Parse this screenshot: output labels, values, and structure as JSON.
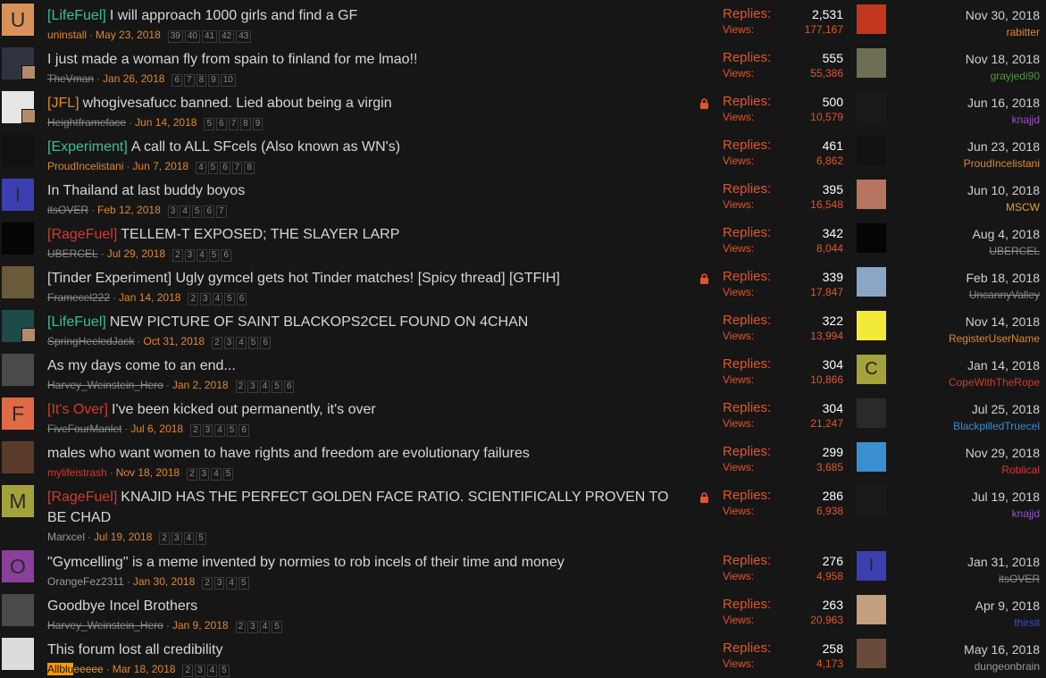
{
  "threads": [
    {
      "avatar_letter": "U",
      "avatar_color": "#d9915a",
      "prefix": "[LifeFuel]",
      "prefix_color": "#3dbd9f",
      "title": "I will approach 1000 girls and find a GF",
      "author": "uninstall",
      "author_color": "#e0882a",
      "date": "May 23, 2018",
      "pages": [
        "39",
        "40",
        "41",
        "42",
        "43"
      ],
      "locked": false,
      "replies_label": "Replies:",
      "replies": "2,531",
      "views_label": "Views:",
      "views": "177,167",
      "last_avatar_color": "#c4371f",
      "last_date": "Nov 30, 2018",
      "last_user": "rabitter",
      "last_user_color": "#e0882a"
    },
    {
      "avatar_letter": "",
      "avatar_color": "#2f3340",
      "prefix": "",
      "prefix_color": "",
      "title": "I just made a woman fly from spain to finland for me lmao!!",
      "author": "TheVman",
      "author_color": "#8a8a8a",
      "date": "Jan 26, 2018",
      "pages": [
        "6",
        "7",
        "8",
        "9",
        "10"
      ],
      "locked": false,
      "replies_label": "Replies:",
      "replies": "555",
      "views_label": "Views:",
      "views": "55,386",
      "last_avatar_color": "#6e6e52",
      "last_date": "Nov 18, 2018",
      "last_user": "grayjedi90",
      "last_user_color": "#4f9a3f"
    },
    {
      "avatar_letter": "",
      "avatar_color": "#e6e6e6",
      "prefix": "[JFL]",
      "prefix_color": "#e0882a",
      "title": "whogivesafucc banned. Lied about being a virgin",
      "author": "Heightframeface",
      "author_color": "#8a8a8a",
      "date": "Jun 14, 2018",
      "pages": [
        "5",
        "6",
        "7",
        "8",
        "9"
      ],
      "locked": true,
      "replies_label": "Replies:",
      "replies": "500",
      "views_label": "Views:",
      "views": "10,579",
      "last_avatar_color": "#1a1a1a",
      "last_date": "Jun 16, 2018",
      "last_user": "knajjd",
      "last_user_color": "#9b4fd1"
    },
    {
      "avatar_letter": "",
      "avatar_color": "#111111",
      "prefix": "[Experiment]",
      "prefix_color": "#3dbd9f",
      "title": "A call to ALL SFcels (Also known as WN's)",
      "author": "ProudIncelistani",
      "author_color": "#e0882a",
      "date": "Jun 7, 2018",
      "pages": [
        "4",
        "5",
        "6",
        "7",
        "8"
      ],
      "locked": false,
      "replies_label": "Replies:",
      "replies": "461",
      "views_label": "Views:",
      "views": "6,862",
      "last_avatar_color": "#111111",
      "last_date": "Jun 23, 2018",
      "last_user": "ProudIncelistani",
      "last_user_color": "#e0882a"
    },
    {
      "avatar_letter": "I",
      "avatar_color": "#3b3fb0",
      "prefix": "",
      "prefix_color": "",
      "title": "In Thailand at last buddy boyos",
      "author": "itsOVER",
      "author_color": "#8a8a8a",
      "date": "Feb 12, 2018",
      "pages": [
        "3",
        "4",
        "5",
        "6",
        "7"
      ],
      "locked": false,
      "replies_label": "Replies:",
      "replies": "395",
      "views_label": "Views:",
      "views": "16,548",
      "last_avatar_color": "#b57560",
      "last_date": "Jun 10, 2018",
      "last_user": "MSCW",
      "last_user_color": "#e0a02a"
    },
    {
      "avatar_letter": "",
      "avatar_color": "#050505",
      "prefix": "[RageFuel]",
      "prefix_color": "#d23b2a",
      "title": "TELLEM-T EXPOSED; THE SLAYER LARP",
      "author": "UBERCEL",
      "author_color": "#8a8a8a",
      "date": "Jul 29, 2018",
      "pages": [
        "2",
        "3",
        "4",
        "5",
        "6"
      ],
      "locked": false,
      "replies_label": "Replies:",
      "replies": "342",
      "views_label": "Views:",
      "views": "8,044",
      "last_avatar_color": "#050505",
      "last_date": "Aug 4, 2018",
      "last_user": "UBERCEL",
      "last_user_color": "#8a8a8a"
    },
    {
      "avatar_letter": "",
      "avatar_color": "#6b5a3a",
      "prefix": "",
      "prefix_color": "",
      "title": "[Tinder Experiment] Ugly gymcel gets hot Tinder matches! [Spicy thread] [GTFIH]",
      "author": "Framecel222",
      "author_color": "#8a8a8a",
      "date": "Jan 14, 2018",
      "pages": [
        "2",
        "3",
        "4",
        "5",
        "6"
      ],
      "locked": true,
      "replies_label": "Replies:",
      "replies": "339",
      "views_label": "Views:",
      "views": "17,847",
      "last_avatar_color": "#8aa6c4",
      "last_date": "Feb 18, 2018",
      "last_user": "UncannyValley",
      "last_user_color": "#8a8a8a"
    },
    {
      "avatar_letter": "",
      "avatar_color": "#1f4a4a",
      "prefix": "[LifeFuel]",
      "prefix_color": "#3dbd9f",
      "title": "NEW PICTURE OF SAINT BLACKOPS2CEL FOUND ON 4CHAN",
      "author": "SpringHeeledJack",
      "author_color": "#8a8a8a",
      "date": "Oct 31, 2018",
      "pages": [
        "2",
        "3",
        "4",
        "5",
        "6"
      ],
      "locked": false,
      "replies_label": "Replies:",
      "replies": "322",
      "views_label": "Views:",
      "views": "13,994",
      "last_avatar_color": "#f2e93a",
      "last_date": "Nov 14, 2018",
      "last_user": "RegisterUserName",
      "last_user_color": "#e0882a"
    },
    {
      "avatar_letter": "",
      "avatar_color": "#4a4a4a",
      "prefix": "",
      "prefix_color": "",
      "title": "As my days come to an end...",
      "author": "Harvey_Weinstein_Hero",
      "author_color": "#8a8a8a",
      "date": "Jan 2, 2018",
      "pages": [
        "2",
        "3",
        "4",
        "5",
        "6"
      ],
      "locked": false,
      "replies_label": "Replies:",
      "replies": "304",
      "views_label": "Views:",
      "views": "10,866",
      "last_avatar_letter": "C",
      "last_avatar_color": "#a3a33a",
      "last_date": "Jan 14, 2018",
      "last_user": "CopeWithTheRope",
      "last_user_color": "#d23b2a"
    },
    {
      "avatar_letter": "F",
      "avatar_color": "#e06a45",
      "prefix": "[It's Over]",
      "prefix_color": "#d23b2a",
      "title": "I've been kicked out permanently, it's over",
      "author": "FiveFourManlet",
      "author_color": "#8a8a8a",
      "date": "Jul 6, 2018",
      "pages": [
        "2",
        "3",
        "4",
        "5",
        "6"
      ],
      "locked": false,
      "replies_label": "Replies:",
      "replies": "304",
      "views_label": "Views:",
      "views": "21,247",
      "last_avatar_color": "#2a2a2a",
      "last_date": "Jul 25, 2018",
      "last_user": "BlackpilledTruecel",
      "last_user_color": "#3a8fd1"
    },
    {
      "avatar_letter": "",
      "avatar_color": "#5a3a2a",
      "prefix": "",
      "prefix_color": "",
      "title": "males who want women to have rights and freedom are evolutionary failures",
      "author": "mylifeistrash",
      "author_color": "#d23b2a",
      "date": "Nov 18, 2018",
      "pages": [
        "2",
        "3",
        "4",
        "5"
      ],
      "locked": false,
      "replies_label": "Replies:",
      "replies": "299",
      "views_label": "Views:",
      "views": "3,685",
      "last_avatar_color": "#3a8fd1",
      "last_date": "Nov 29, 2018",
      "last_user": "Roblical",
      "last_user_color": "#d23b2a"
    },
    {
      "avatar_letter": "M",
      "avatar_color": "#a3a33a",
      "prefix": "[RageFuel]",
      "prefix_color": "#d23b2a",
      "title": "KNAJID HAS THE PERFECT GOLDEN FACE RATIO. SCIENTIFICALLY PROVEN TO BE CHAD",
      "author": "Marxcel",
      "author_color": "#9a9a9a",
      "date": "Jul 19, 2018",
      "pages": [
        "2",
        "3",
        "4",
        "5"
      ],
      "locked": true,
      "replies_label": "Replies:",
      "replies": "286",
      "views_label": "Views:",
      "views": "6,938",
      "last_avatar_color": "#1a1a1a",
      "last_date": "Jul 19, 2018",
      "last_user": "knajjd",
      "last_user_color": "#9b4fd1"
    },
    {
      "avatar_letter": "O",
      "avatar_color": "#8a3f9b",
      "prefix": "",
      "prefix_color": "",
      "title": "\"Gymcelling\" is a meme invented by normies to rob incels of their time and money",
      "author": "OrangeFez2311",
      "author_color": "#9a9a9a",
      "date": "Jan 30, 2018",
      "pages": [
        "2",
        "3",
        "4",
        "5"
      ],
      "locked": false,
      "replies_label": "Replies:",
      "replies": "276",
      "views_label": "Views:",
      "views": "4,958",
      "last_avatar_letter": "I",
      "last_avatar_color": "#3b3fb0",
      "last_date": "Jan 31, 2018",
      "last_user": "itsOVER",
      "last_user_color": "#8a8a8a"
    },
    {
      "avatar_letter": "",
      "avatar_color": "#4a4a4a",
      "prefix": "",
      "prefix_color": "",
      "title": "Goodbye Incel Brothers",
      "author": "Harvey_Weinstein_Hero",
      "author_color": "#8a8a8a",
      "date": "Jan 9, 2018",
      "pages": [
        "2",
        "3",
        "4",
        "5"
      ],
      "locked": false,
      "replies_label": "Replies:",
      "replies": "263",
      "views_label": "Views:",
      "views": "20,963",
      "last_avatar_color": "#c4a080",
      "last_date": "Apr 9, 2018",
      "last_user": "thirsit",
      "last_user_color": "#3a4fd1"
    },
    {
      "avatar_letter": "",
      "avatar_color": "#dcdcdc",
      "prefix": "",
      "prefix_color": "",
      "title": "This forum lost all credibility",
      "author_highlight": "Allblu",
      "author": "eeeee",
      "author_color": "#e0a02a",
      "date": "Mar 18, 2018",
      "pages": [
        "2",
        "3",
        "4",
        "5"
      ],
      "locked": false,
      "replies_label": "Replies:",
      "replies": "258",
      "views_label": "Views:",
      "views": "4,173",
      "last_avatar_color": "#6a4a3a",
      "last_date": "May 16, 2018",
      "last_user": "dungeonbrain",
      "last_user_color": "#9a9a9a"
    }
  ]
}
